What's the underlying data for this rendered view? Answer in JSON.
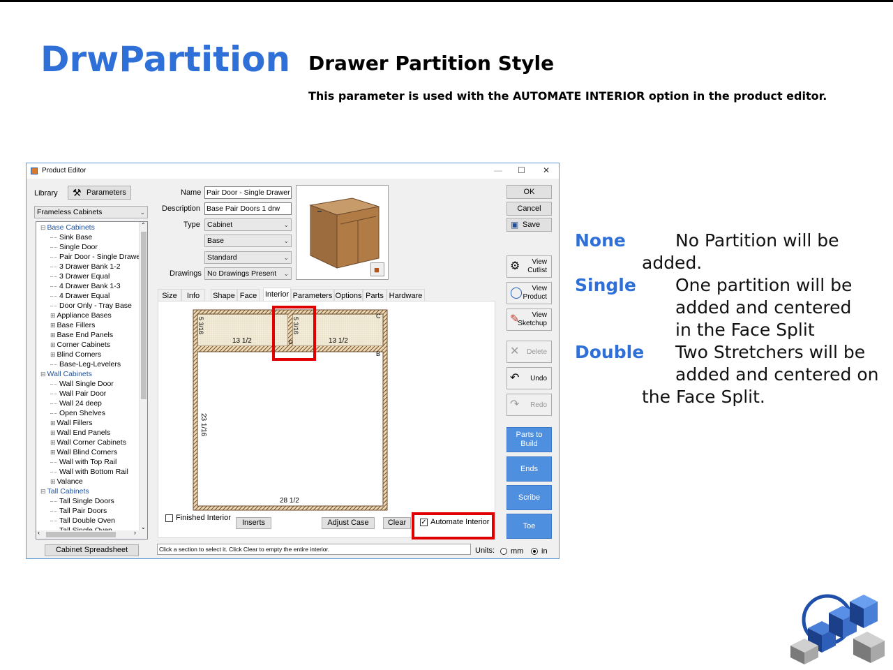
{
  "slide": {
    "title": "DrwPartition",
    "subtitle": "Drawer Partition Style",
    "description": "This parameter is used with the AUTOMATE INTERIOR option in the product editor."
  },
  "window": {
    "title": "Product Editor",
    "controls": [
      "—",
      "☐",
      "✕"
    ]
  },
  "library": {
    "label": "Library",
    "parameters_button": "Parameters",
    "selected": "Frameless Cabinets",
    "spreadsheet_button": "Cabinet Spreadsheet",
    "tree": [
      {
        "text": "Base Cabinets",
        "level": 0,
        "expander": "⊟"
      },
      {
        "text": "Sink Base",
        "level": 1,
        "expander": ""
      },
      {
        "text": "Single Door",
        "level": 1,
        "expander": ""
      },
      {
        "text": "Pair Door - Single Drawer",
        "level": 1,
        "expander": ""
      },
      {
        "text": "3 Drawer Bank 1-2",
        "level": 1,
        "expander": ""
      },
      {
        "text": "3 Drawer Equal",
        "level": 1,
        "expander": ""
      },
      {
        "text": "4 Drawer Bank 1-3",
        "level": 1,
        "expander": ""
      },
      {
        "text": "4 Drawer Equal",
        "level": 1,
        "expander": ""
      },
      {
        "text": "Door Only - Tray Base",
        "level": 1,
        "expander": ""
      },
      {
        "text": "Appliance Bases",
        "level": 1,
        "expander": "⊞"
      },
      {
        "text": "Base Fillers",
        "level": 1,
        "expander": "⊞"
      },
      {
        "text": "Base End Panels",
        "level": 1,
        "expander": "⊞"
      },
      {
        "text": "Corner Cabinets",
        "level": 1,
        "expander": "⊞"
      },
      {
        "text": "Blind Corners",
        "level": 1,
        "expander": "⊞"
      },
      {
        "text": "Base-Leg-Levelers",
        "level": 1,
        "expander": ""
      },
      {
        "text": "Wall Cabinets",
        "level": 0,
        "expander": "⊟"
      },
      {
        "text": "Wall Single Door",
        "level": 1,
        "expander": ""
      },
      {
        "text": "Wall Pair Door",
        "level": 1,
        "expander": ""
      },
      {
        "text": "Wall 24 deep",
        "level": 1,
        "expander": ""
      },
      {
        "text": "Open Shelves",
        "level": 1,
        "expander": ""
      },
      {
        "text": "Wall Fillers",
        "level": 1,
        "expander": "⊞"
      },
      {
        "text": "Wall End Panels",
        "level": 1,
        "expander": "⊞"
      },
      {
        "text": "Wall Corner Cabinets",
        "level": 1,
        "expander": "⊞"
      },
      {
        "text": "Wall Blind Corners",
        "level": 1,
        "expander": "⊞"
      },
      {
        "text": "Wall with Top Rail",
        "level": 1,
        "expander": ""
      },
      {
        "text": "Wall with Bottom Rail",
        "level": 1,
        "expander": ""
      },
      {
        "text": "Valance",
        "level": 1,
        "expander": "⊞"
      },
      {
        "text": "Tall Cabinets",
        "level": 0,
        "expander": "⊟"
      },
      {
        "text": "Tall Single Doors",
        "level": 1,
        "expander": ""
      },
      {
        "text": "Tall Pair Doors",
        "level": 1,
        "expander": ""
      },
      {
        "text": "Tall Double Oven",
        "level": 1,
        "expander": ""
      },
      {
        "text": "Tall Single Oven",
        "level": 1,
        "expander": ""
      }
    ]
  },
  "form": {
    "name_label": "Name",
    "name_value": "Pair Door - Single Drawer",
    "description_label": "Description",
    "description_value": "Base Pair Doors 1 drw",
    "type_label": "Type",
    "type_value": "Cabinet",
    "type2_value": "Base",
    "type3_value": "Standard",
    "drawings_label": "Drawings",
    "drawings_value": "No Drawings Present"
  },
  "buttons": {
    "ok": "OK",
    "cancel": "Cancel",
    "save": "Save",
    "view_cutlist": "View\nCutlist",
    "view_product": "View\nProduct",
    "view_sketchup": "View\nSketchup",
    "delete": "Delete",
    "undo": "Undo",
    "redo": "Redo",
    "parts_to_build": "Parts to\nBuild",
    "ends": "Ends",
    "scribe": "Scribe",
    "toe": "Toe"
  },
  "tabs": [
    "Size",
    "Info",
    "Shape",
    "Face",
    "Interior",
    "Parameters",
    "Options",
    "Parts",
    "Hardware"
  ],
  "active_tab": "Interior",
  "interior": {
    "dim_left_vertical": "5 3/16",
    "dim_center_vertical": "5 3/16",
    "dim_left_width": "13 1/2",
    "dim_right_width": "13 1/2",
    "dim_height": "23 1/16",
    "dim_width": "28 1/2",
    "section_c": "C",
    "section_b": "B",
    "section_d": "D",
    "finished_interior": "Finished Interior",
    "inserts": "Inserts",
    "adjust_case": "Adjust Case",
    "clear": "Clear",
    "automate_interior": "Automate Interior"
  },
  "status_text": "Click a section to select it. Click Clear to empty the entire interior.",
  "units": {
    "label": "Units:",
    "mm": "mm",
    "in": "in",
    "selected": "in"
  },
  "options": [
    {
      "key": "None",
      "text": "No Partition will be\nadded."
    },
    {
      "key": "Single",
      "text": "One partition will be\nadded and centered\nin the Face Split"
    },
    {
      "key": "Double",
      "text": "Two Stretchers will be\nadded and centered on\nthe Face Split."
    }
  ],
  "colors": {
    "accent": "#2e6fd8",
    "button_blue": "#4f8fe0",
    "highlight": "#e00000"
  }
}
